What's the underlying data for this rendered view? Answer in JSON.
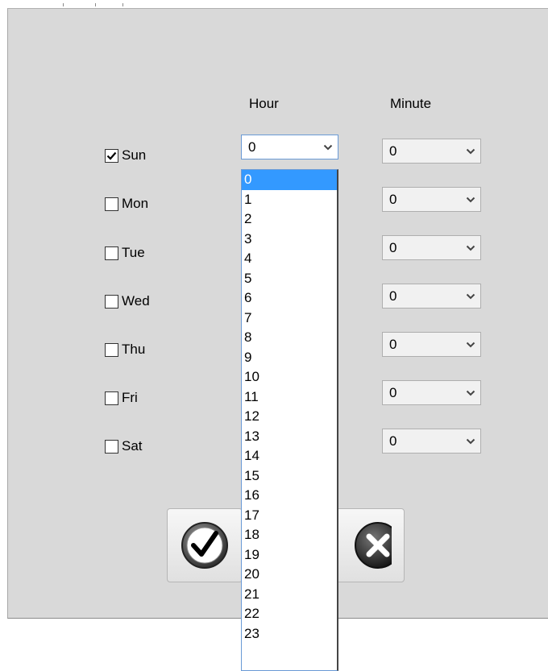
{
  "headers": {
    "hour": "Hour",
    "minute": "Minute"
  },
  "days": [
    {
      "label": "Sun",
      "checked": true
    },
    {
      "label": "Mon",
      "checked": false
    },
    {
      "label": "Tue",
      "checked": false
    },
    {
      "label": "Wed",
      "checked": false
    },
    {
      "label": "Thu",
      "checked": false
    },
    {
      "label": "Fri",
      "checked": false
    },
    {
      "label": "Sat",
      "checked": false
    }
  ],
  "hour_combo": {
    "value": "0"
  },
  "minute_combos": [
    "0",
    "0",
    "0",
    "0",
    "0",
    "0",
    "0"
  ],
  "hour_options": [
    "0",
    "1",
    "2",
    "3",
    "4",
    "5",
    "6",
    "7",
    "8",
    "9",
    "10",
    "11",
    "12",
    "13",
    "14",
    "15",
    "16",
    "17",
    "18",
    "19",
    "20",
    "21",
    "22",
    "23"
  ],
  "hour_selected": "0",
  "buttons": {
    "ok_icon": "checkmark-circle-icon",
    "cancel_icon": "close-circle-icon"
  },
  "colors": {
    "selection": "#3399ff",
    "panel": "#d9d9d9",
    "focus_border": "#6a9ad6"
  }
}
